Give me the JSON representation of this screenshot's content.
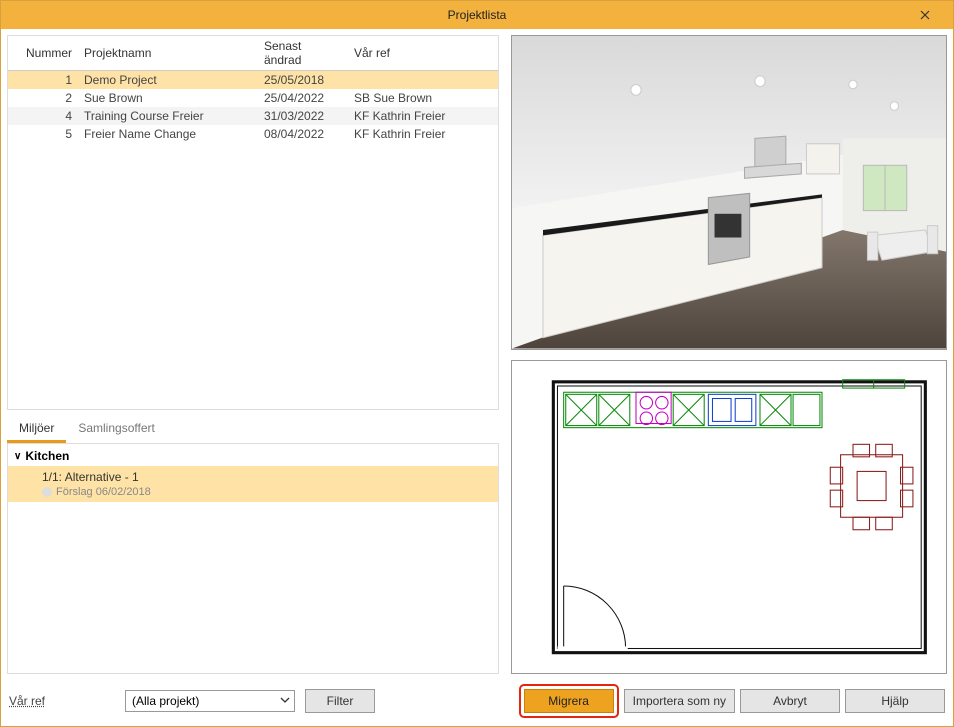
{
  "window": {
    "title": "Projektlista"
  },
  "table": {
    "headers": {
      "num": "Nummer",
      "name": "Projektnamn",
      "date": "Senast ändrad",
      "ref": "Vår ref"
    },
    "rows": [
      {
        "num": "1",
        "name": "Demo Project",
        "date": "25/05/2018",
        "ref": ""
      },
      {
        "num": "2",
        "name": "Sue Brown",
        "date": "25/04/2022",
        "ref": "SB Sue Brown"
      },
      {
        "num": "4",
        "name": "Training Course Freier",
        "date": "31/03/2022",
        "ref": "KF Kathrin Freier"
      },
      {
        "num": "5",
        "name": "Freier Name Change",
        "date": "08/04/2022",
        "ref": "KF Kathrin Freier"
      }
    ]
  },
  "tabs": {
    "env": "Miljöer",
    "quote": "Samlingsoffert"
  },
  "tree": {
    "root": "Kitchen",
    "alt_title": "1/1: Alternative - 1",
    "alt_status": "Förslag 06/02/2018"
  },
  "footer": {
    "ref_label": "Vår ref",
    "project_filter": "(Alla projekt)",
    "filter": "Filter",
    "migrate": "Migrera",
    "import_new": "Importera som ny",
    "cancel": "Avbryt",
    "help": "Hjälp"
  }
}
